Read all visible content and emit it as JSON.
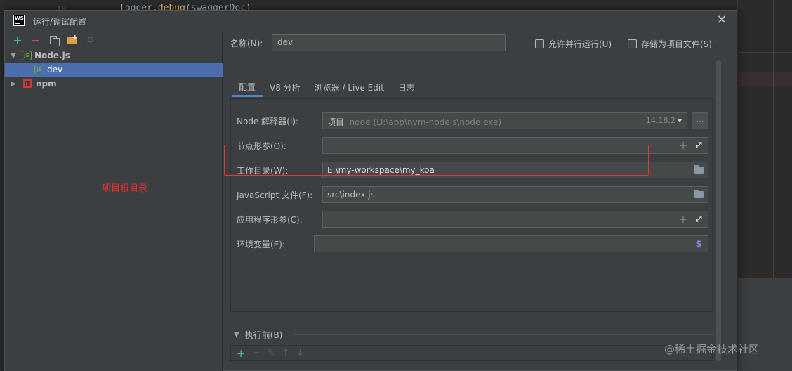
{
  "background": {
    "line_number": "18",
    "code_prefix": "logger.",
    "code_fn": "debug",
    "code_suffix": "(swaggerDoc)"
  },
  "dialog": {
    "title": "运行/调试配置",
    "app_logo": "WS"
  },
  "toolbar": {
    "add": "+",
    "remove": "−"
  },
  "tree": {
    "items": [
      {
        "label": "Node.js",
        "icon": "nodejs-icon",
        "expanded": true
      },
      {
        "label": "dev",
        "icon": "nodejs-icon",
        "selected": true
      },
      {
        "label": "npm",
        "icon": "npm-icon",
        "expanded": false
      }
    ]
  },
  "annotation": {
    "text": "项目根目录",
    "color": "#e8312f"
  },
  "name": {
    "label": "名称(N):",
    "value": "dev"
  },
  "options": {
    "parallel": "允许并行运行(U)",
    "store": "存储为项目文件(S)"
  },
  "tabs": [
    "配置",
    "V8 分析",
    "浏览器 / Live Edit",
    "日志"
  ],
  "fields": {
    "interpreter": {
      "label": "Node 解释器(I):",
      "prefix": "项目",
      "value": "node (D:\\app\\nvm-nodejs\\node.exe)",
      "version": "14.18.2",
      "browse": "..."
    },
    "node_params": {
      "label": "节点形参(O):",
      "value": ""
    },
    "working_dir": {
      "label": "工作目录(W):",
      "value": "E:\\my-workspace\\my_koa"
    },
    "js_file": {
      "label": "JavaScript 文件(F):",
      "value": "src\\index.js"
    },
    "app_params": {
      "label": "应用程序形参(C):",
      "value": ""
    },
    "env_vars": {
      "label": "环境变量(E):",
      "value": ""
    }
  },
  "before_run": {
    "label": "执行前(B)"
  },
  "watermark": "@稀土掘金技术社区",
  "colors": {
    "accent": "#4b6eaf",
    "tab_underline": "#4a88c7",
    "highlight": "#e0383b"
  }
}
